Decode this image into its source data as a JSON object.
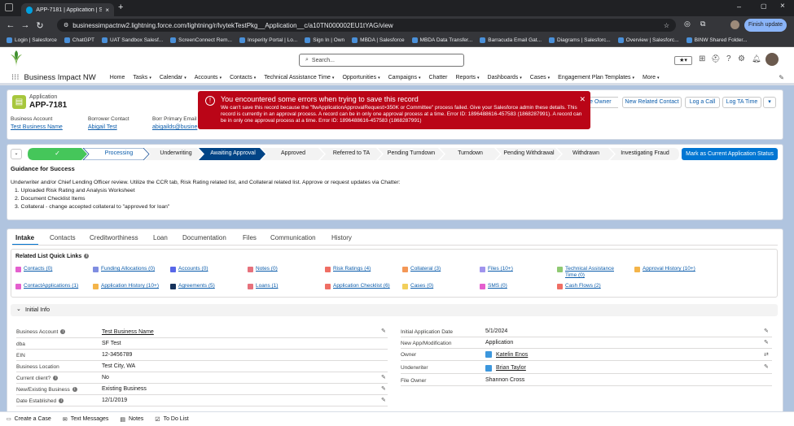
{
  "browser": {
    "tab_title": "APP-7181 | Application | Salesfo",
    "url": "businessimpactnw2.lightning.force.com/lightning/r/lvytekTestPkg__Application__c/a10TN000002EU1tYAG/view",
    "finish_update": "Finish update",
    "bookmarks": [
      "Login | Salesforce",
      "ChatGPT",
      "UAT Sandbox Salesf...",
      "ScreenConnect Rem...",
      "Insperity Portal | Lo...",
      "Sign In | Own",
      "MBDA | Salesforce",
      "MBDA Data Transfer...",
      "Barracuda Email Gat...",
      "Diagrams | Salesforc...",
      "Overview | Salesforc...",
      "BINW Shared Folder..."
    ]
  },
  "header": {
    "search_placeholder": "Search...",
    "app_name": "Business Impact NW"
  },
  "nav": [
    "Home",
    "Tasks",
    "Calendar",
    "Accounts",
    "Contacts",
    "Technical Assistance Time",
    "Opportunities",
    "Campaigns",
    "Chatter",
    "Reports",
    "Dashboards",
    "Cases",
    "Engagement Plan Templates",
    "More"
  ],
  "nav_has_chevron": [
    false,
    true,
    true,
    true,
    true,
    true,
    true,
    true,
    false,
    true,
    true,
    true,
    true,
    true
  ],
  "record": {
    "object_label": "Application",
    "name": "APP-7181",
    "fields": [
      {
        "label": "Business Account",
        "value": "Test Business Name"
      },
      {
        "label": "Borrower Contact",
        "value": "Abigail Test"
      },
      {
        "label": "Borr Primary Email",
        "value": "abigailds@busine"
      }
    ],
    "buttons": [
      "...e Owner",
      "New Related Contact",
      "Log a Call",
      "Log TA Time"
    ]
  },
  "toast": {
    "title": "You encountered some errors when trying to save this record",
    "message": "We can't save this record because the \"flwApplicationApprovalRequest>350K or Committee\" process failed. Give your Salesforce admin these details. This record is currently in an approval process. A record can be in only one approval process at a time. Error ID: 1896488616-457583 (1868287991). A record can be in only one approval process at a time. Error ID: 1896488616-457583 (1868287991)"
  },
  "path": {
    "stages": [
      "✓",
      "Processing",
      "Underwriting",
      "Awaiting Approval",
      "Approved",
      "Referred to TA",
      "Pending Turndown",
      "Turndown",
      "Pending Withdrawal",
      "Withdrawn",
      "Investigating Fraud"
    ],
    "mark_button": "Mark as Current Application Status",
    "guidance_title": "Guidance for Success",
    "guidance_intro": "Underwriter and/or Chief Lending Officer review. Utilize the CCR tab, Risk Rating related list, and Collateral related list. Approve or request updates via Chatter:",
    "guidance_items": [
      "1. Uploaded Risk Rating and Analysis Worksheet",
      "2. Document Checklist Items",
      "3. Collateral - change accepted collateral to \"approved for loan\""
    ]
  },
  "tabs": [
    "Intake",
    "Contacts",
    "Creditworthiness",
    "Loan",
    "Documentation",
    "Files",
    "Communication",
    "History"
  ],
  "quick_links": {
    "title": "Related List Quick Links",
    "items": [
      {
        "label": "Contacts (0)",
        "color": "#e45fce"
      },
      {
        "label": "Funding Allocations (0)",
        "color": "#7f8de1"
      },
      {
        "label": "Accounts (0)",
        "color": "#5867e8"
      },
      {
        "label": "Notes (0)",
        "color": "#e6717c"
      },
      {
        "label": "Risk Ratings (4)",
        "color": "#ef6e64"
      },
      {
        "label": "Collateral (3)",
        "color": "#f49756"
      },
      {
        "label": "Files (10+)",
        "color": "#a094ed"
      },
      {
        "label": "Technical Assistance Time (0)",
        "color": "#8fc972"
      },
      {
        "label": "Approval History (10+)",
        "color": "#f4b449"
      },
      {
        "label": "ContactApplications (1)",
        "color": "#e45fce"
      },
      {
        "label": "Application History (10+)",
        "color": "#f4b449"
      },
      {
        "label": "Agreements (5)",
        "color": "#16325c"
      },
      {
        "label": "Loans (1)",
        "color": "#e6717c"
      },
      {
        "label": "Application Checklist (6)",
        "color": "#ef6e64"
      },
      {
        "label": "Cases (0)",
        "color": "#f2cf5b"
      },
      {
        "label": "SMS (0)",
        "color": "#e45fce"
      },
      {
        "label": "Cash Flows (2)",
        "color": "#ef6e64"
      }
    ]
  },
  "section": {
    "title": "Initial Info",
    "left": [
      {
        "label": "Business Account",
        "value": "Test Business Name",
        "link": true,
        "info": true
      },
      {
        "label": "dba",
        "value": "SF Test"
      },
      {
        "label": "EIN",
        "value": "12-3456789"
      },
      {
        "label": "Business Location",
        "value": "Test City, WA"
      },
      {
        "label": "Current client?",
        "value": "No",
        "info": true
      },
      {
        "label": "New/Existing Business",
        "value": "Existing Business",
        "info": true
      },
      {
        "label": "Date Established",
        "value": "12/1/2019",
        "info": true
      }
    ],
    "right": [
      {
        "label": "Initial Application Date",
        "value": "5/1/2024"
      },
      {
        "label": "New App/Modification",
        "value": "Application"
      },
      {
        "label": "Owner",
        "value": "Katelin Enos",
        "link": true
      },
      {
        "label": "Underwriter",
        "value": "Brian Taylor",
        "link": true
      },
      {
        "label": "File Owner",
        "value": "Shannon Cross"
      }
    ]
  },
  "utility_bar": [
    "Create a Case",
    "Text Messages",
    "Notes",
    "To Do List"
  ]
}
